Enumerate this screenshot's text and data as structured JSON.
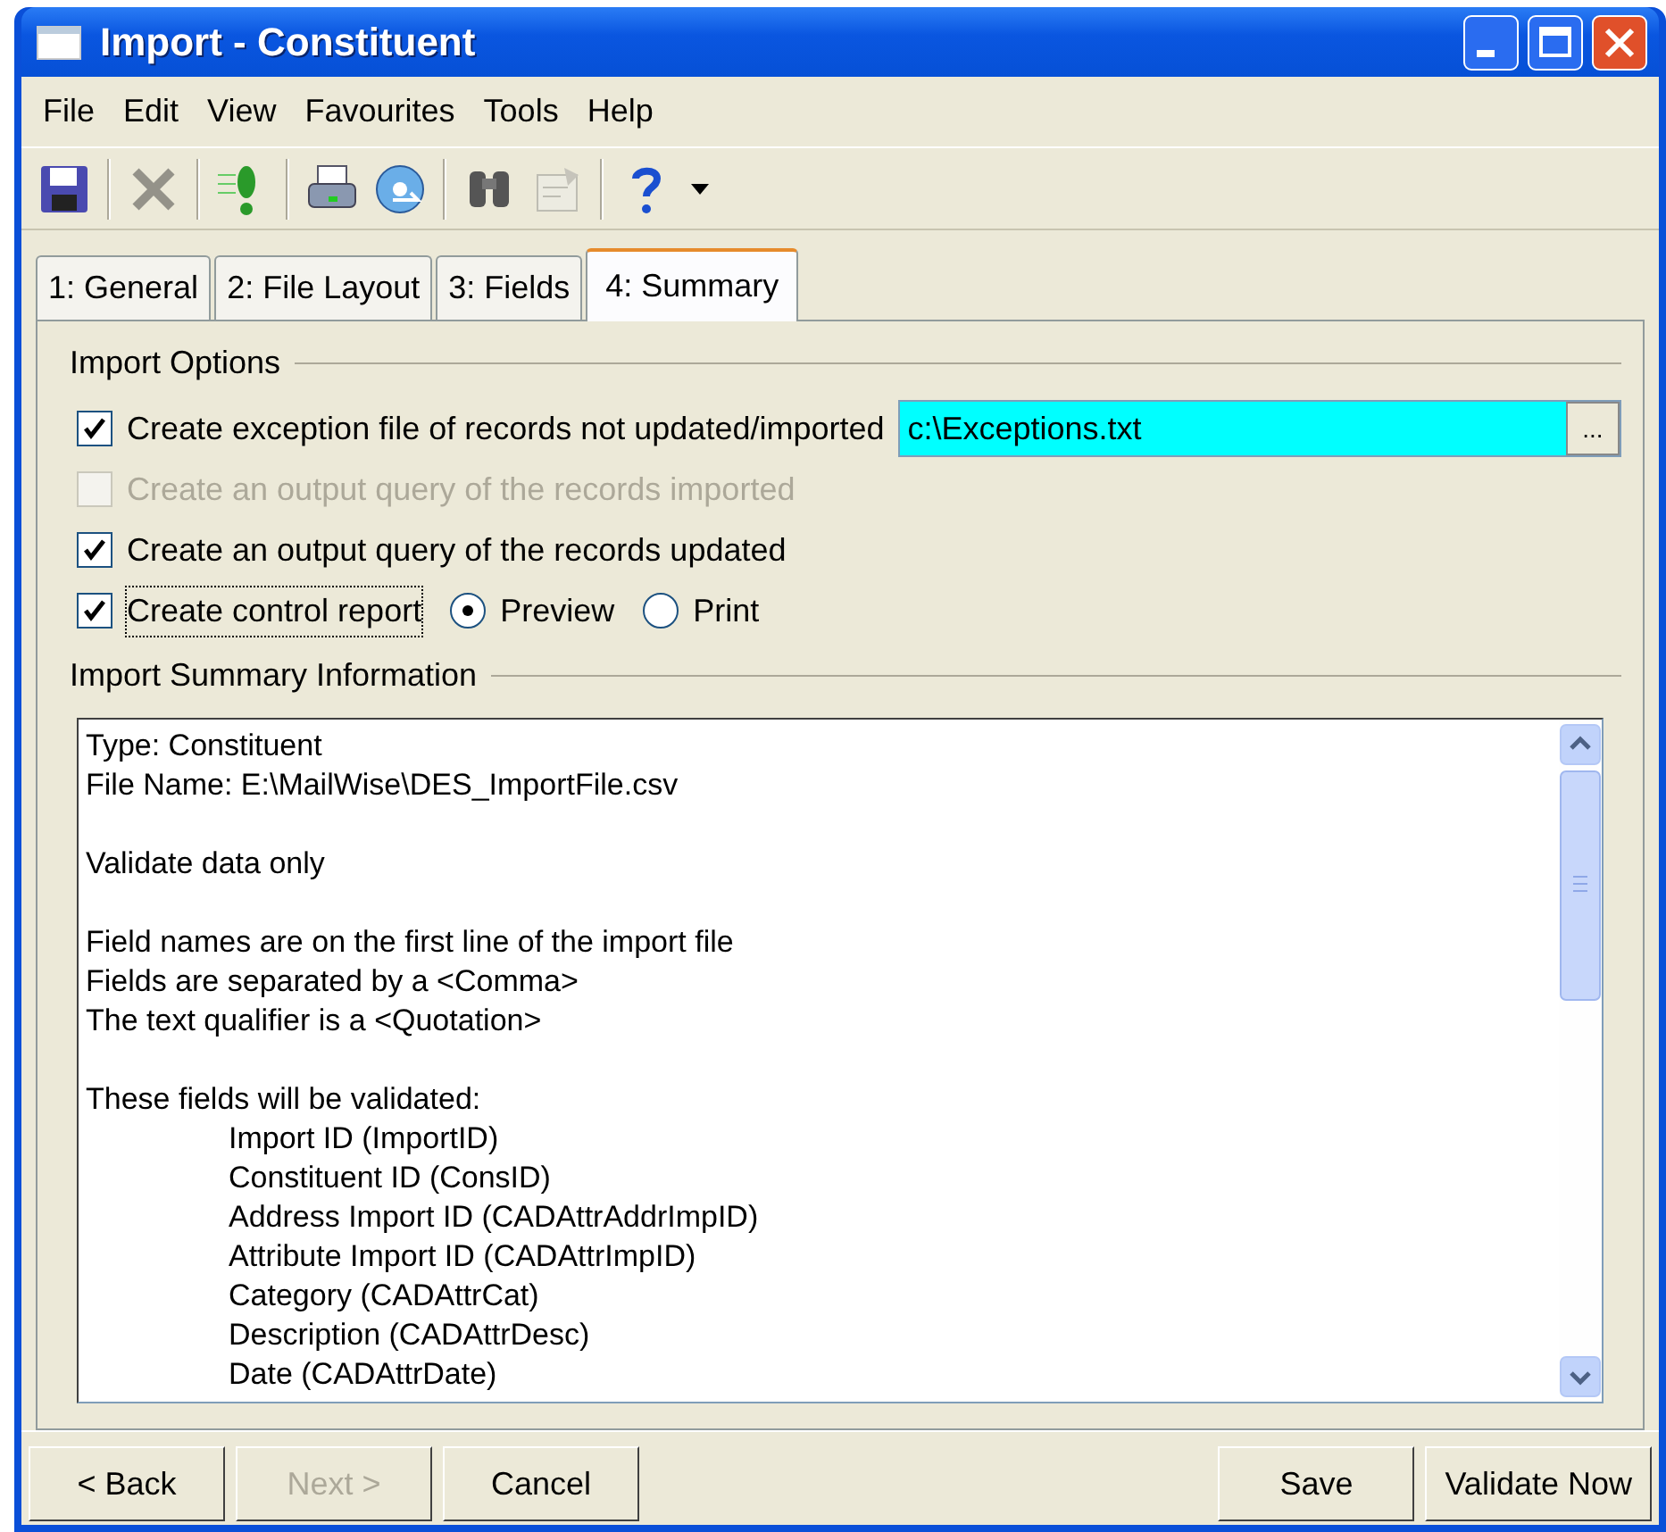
{
  "window": {
    "title": "Import - Constituent"
  },
  "menu": [
    "File",
    "Edit",
    "View",
    "Favourites",
    "Tools",
    "Help"
  ],
  "toolbar": [
    {
      "disabled": false
    },
    {
      "disabled": true
    },
    {
      "disabled": false
    },
    {
      "disabled": false
    },
    {
      "disabled": false
    },
    {
      "disabled": false
    },
    {
      "disabled": true
    },
    {
      "disabled": false
    }
  ],
  "tabs": [
    {
      "label": "1: General",
      "selected": false
    },
    {
      "label": "2: File Layout",
      "selected": false
    },
    {
      "label": "3: Fields",
      "selected": false
    },
    {
      "label": "4: Summary",
      "selected": true
    }
  ],
  "import_options": {
    "heading": "Import Options",
    "options": [
      {
        "kind": "file",
        "label": "Create exception file of records not updated/imported",
        "checked": true,
        "disabled": false,
        "value": "c:\\Exceptions.txt",
        "browse": "..."
      },
      {
        "kind": "plain",
        "label": "Create an output query of the records imported",
        "checked": false,
        "disabled": true
      },
      {
        "kind": "plain",
        "label": "Create an output query of the records updated",
        "checked": true,
        "disabled": false
      },
      {
        "kind": "radios",
        "label": "Create control report",
        "checked": true,
        "disabled": false,
        "focused": true,
        "radios": [
          {
            "label": "Preview",
            "selected": true
          },
          {
            "label": "Print",
            "selected": false
          }
        ]
      }
    ]
  },
  "summary": {
    "heading": "Import Summary Information",
    "blocks": [
      {
        "lines": [
          "Type: Constituent",
          "File Name: E:\\MailWise\\DES_ImportFile.csv"
        ]
      },
      {
        "lines": [
          "Validate data only"
        ]
      },
      {
        "lines": [
          "Field names are on the first line of the import file",
          "Fields are separated by a <Comma>",
          "The text qualifier is a <Quotation>"
        ]
      },
      {
        "lines": [
          "These fields will be validated:"
        ],
        "children": [
          "Import ID (ImportID)",
          "Constituent ID (ConsID)",
          "Address Import ID (CADAttrAddrImpID)",
          "Attribute Import ID (CADAttrImpID)",
          "Category (CADAttrCat)",
          "Description (CADAttrDesc)",
          "Date (CADAttrDate)"
        ]
      }
    ]
  },
  "left_buttons": [
    {
      "label": "< Back",
      "disabled": false
    },
    {
      "label": "Next >",
      "disabled": true
    },
    {
      "label": "Cancel",
      "disabled": false
    }
  ],
  "right_buttons": [
    {
      "label": "Save",
      "disabled": false
    },
    {
      "label": "Validate Now",
      "disabled": false
    }
  ]
}
